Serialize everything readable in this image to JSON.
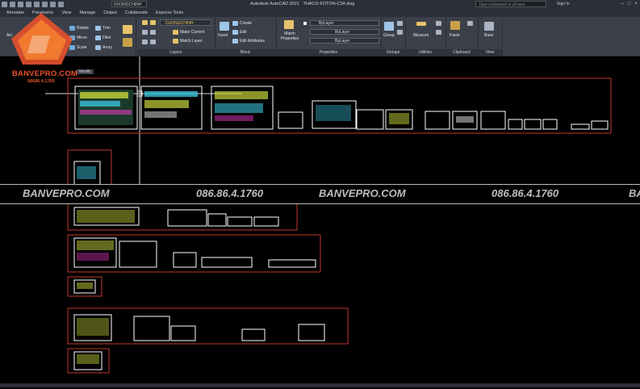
{
  "window": {
    "title": "Autodesk AutoCAD 2021",
    "file": "THACO-FOTON-C34.dwg",
    "layer_dropdown": "DUONGCHINH",
    "search_placeholder": "Type a keyword or phrase",
    "signin": "Sign In",
    "controls": [
      "–",
      "□",
      "×"
    ]
  },
  "menu": [
    "Annotate",
    "Parametric",
    "View",
    "Manage",
    "Output",
    "Collaborate",
    "Express Tools"
  ],
  "ribbon": {
    "modify": {
      "title": "Modify",
      "buttons": [
        "Rotate",
        "Mirror",
        "Scale",
        "Trim",
        "Fillet",
        "Array"
      ],
      "partial_label": "Arc"
    },
    "layers": {
      "title": "Layers",
      "current": "DUONGCHINH",
      "buttons": [
        "Make Current",
        "Match Layer"
      ]
    },
    "block": {
      "title": "Block",
      "buttons": [
        "Insert",
        "Create",
        "Edit",
        "Edit Attributes"
      ]
    },
    "properties": {
      "title": "Properties",
      "match": "Match Properties",
      "rows": [
        "ByLayer",
        "ByLayer",
        "ByLayer"
      ]
    },
    "groups": {
      "title": "Groups",
      "button": "Group"
    },
    "utilities": {
      "title": "Utilities",
      "button": "Measure"
    },
    "clipboard": {
      "title": "Clipboard",
      "button": "Paste"
    },
    "view": {
      "title": "View",
      "button": "Base"
    }
  },
  "logo": {
    "name": "BANVEPRO.COM",
    "phone": "08686.4.1760"
  },
  "watermark": {
    "site": "BANVEPRO.COM",
    "phone": "086.86.4.1760"
  },
  "colors": {
    "accent": "#e8512d",
    "frame_red": "#c0392b",
    "sheet_border": "#ffffff",
    "background": "#000000",
    "ribbon": "#3b404a"
  }
}
